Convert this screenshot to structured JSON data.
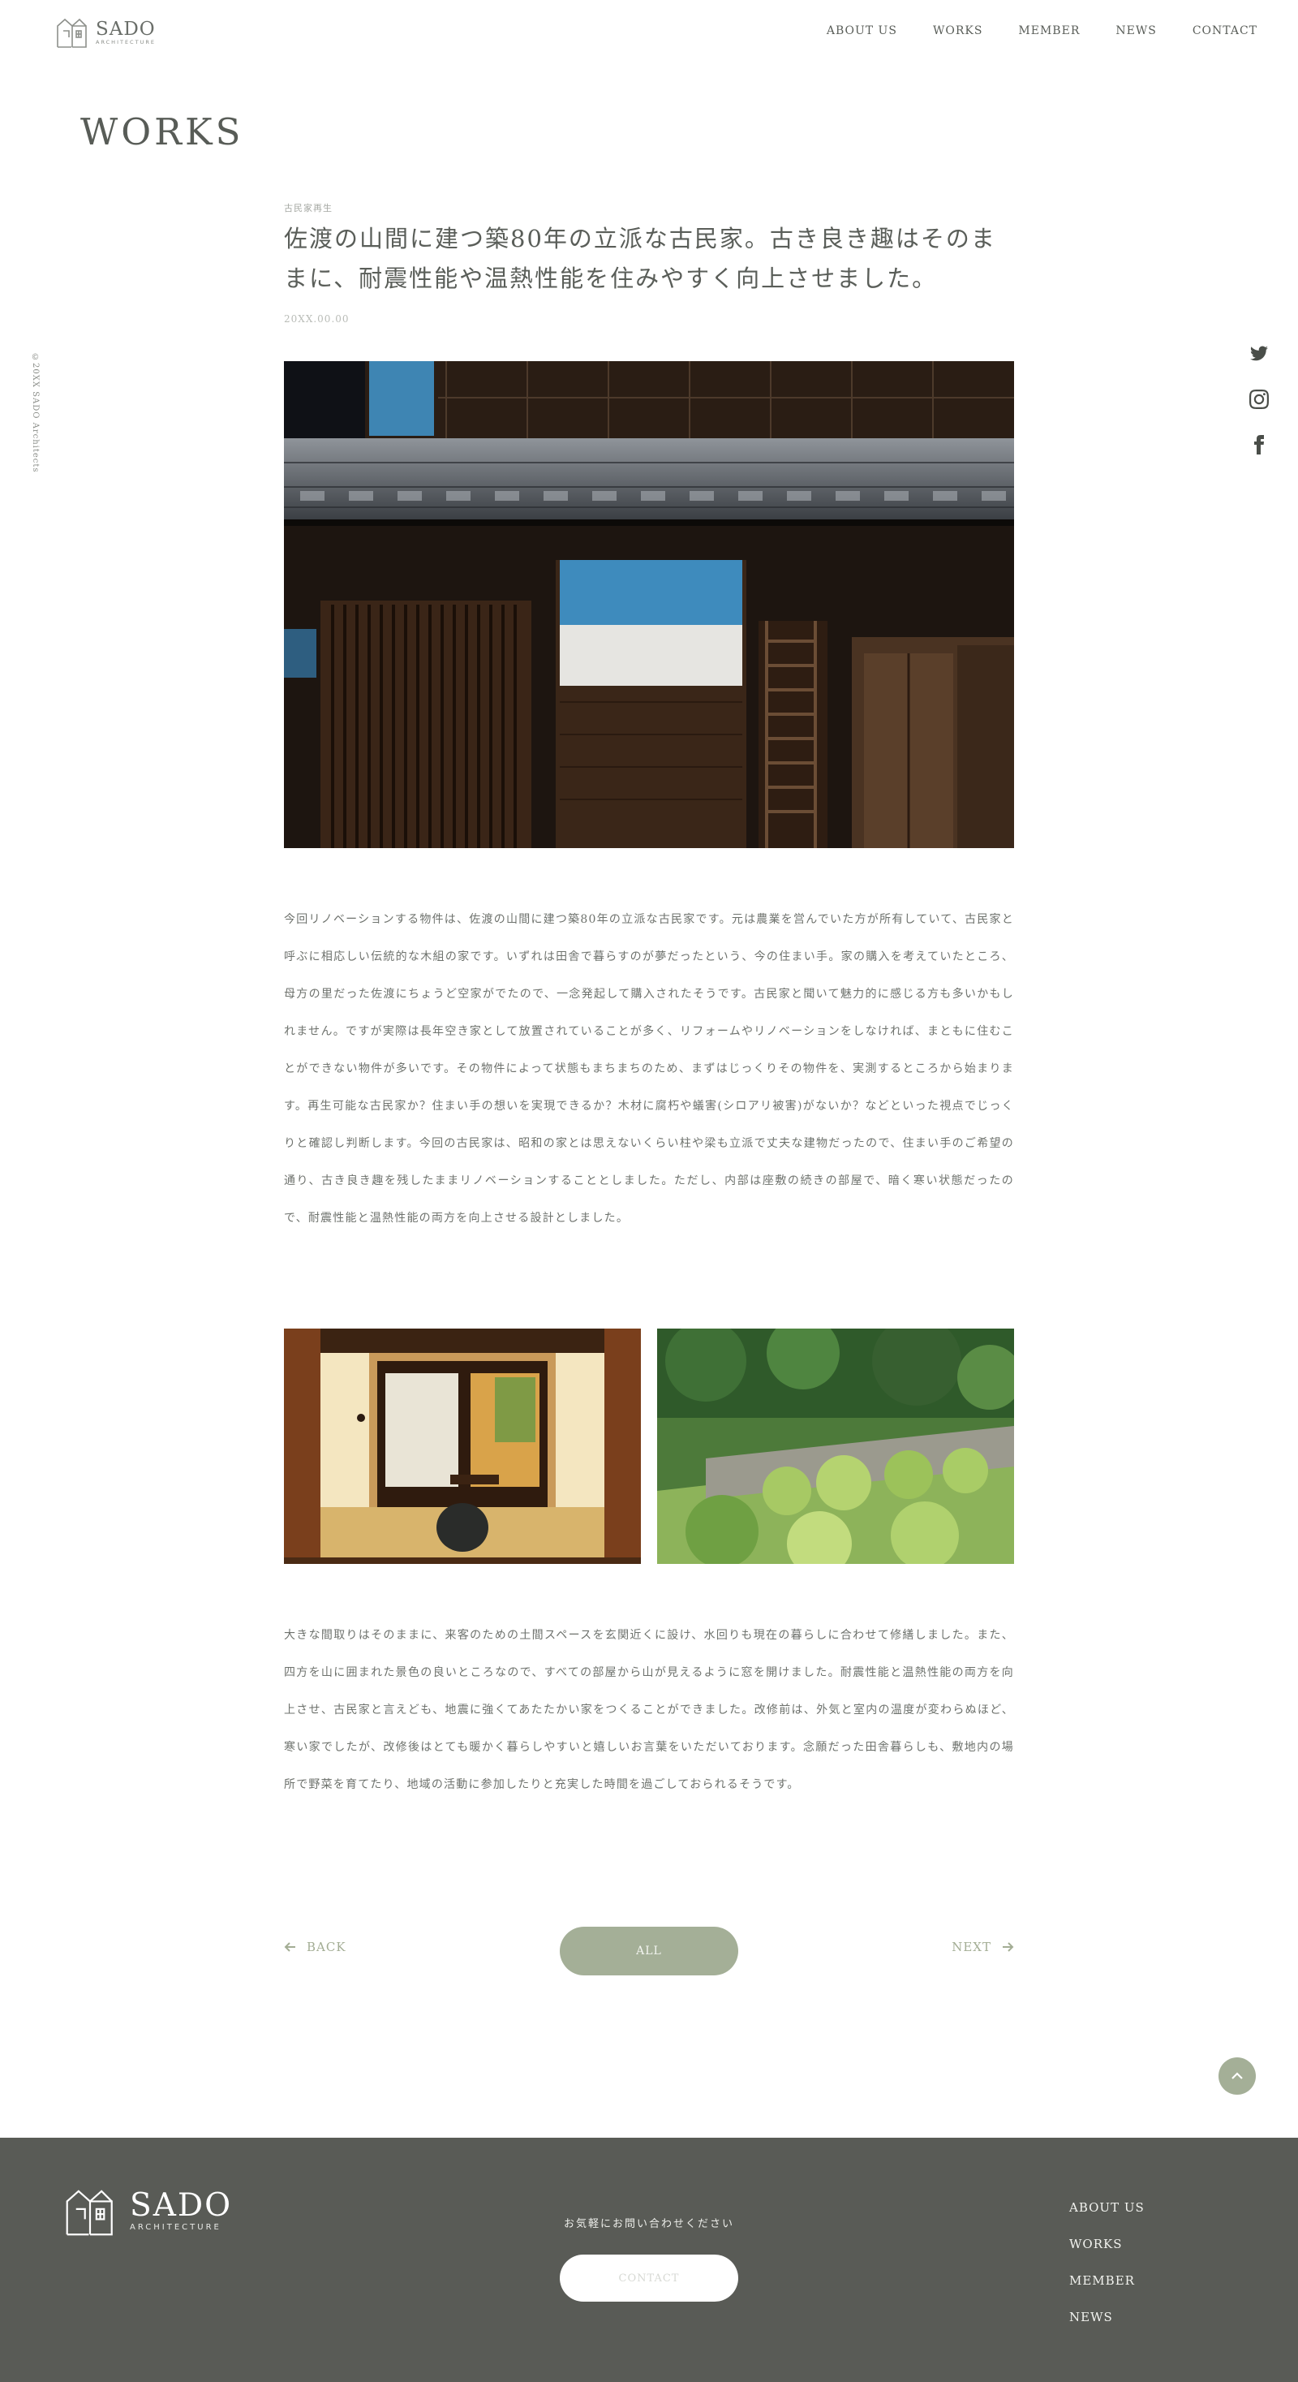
{
  "header": {
    "logo_name": "SADO",
    "logo_sub": "ARCHITECTURE",
    "nav": [
      "ABOUT US",
      "WORKS",
      "MEMBER",
      "NEWS",
      "CONTACT"
    ]
  },
  "page_title": "WORKS",
  "side": {
    "copyright": "©20XX SADO Architects",
    "social_icons": [
      "twitter-icon",
      "instagram-icon",
      "facebook-icon"
    ]
  },
  "article": {
    "category": "古民家再生",
    "title": "佐渡の山間に建つ築80年の立派な古民家。古き良き趣はそのままに、耐震性能や温熱性能を住みやすく向上させました。",
    "date": "20XX.00.00",
    "paragraph1": "今回リノベーションする物件は、佐渡の山間に建つ築80年の立派な古民家です。元は農業を営んでいた方が所有していて、古民家と呼ぶに相応しい伝統的な木組の家です。いずれは田舎で暮らすのが夢だったという、今の住まい手。家の購入を考えていたところ、母方の里だった佐渡にちょうど空家がでたので、一念発起して購入されたそうです。古民家と聞いて魅力的に感じる方も多いかもしれません。ですが実際は長年空き家として放置されていることが多く、リフォームやリノベーションをしなければ、まともに住むことができない物件が多いです。その物件によって状態もまちまちのため、まずはじっくりその物件を、実測するところから始まります。再生可能な古民家か？住まい手の想いを実現できるか？木材に腐朽や蟻害(シロアリ被害)がないか？などといった視点でじっくりと確認し判断します。今回の古民家は、昭和の家とは思えないくらい柱や梁も立派で丈夫な建物だったので、住まい手のご希望の通り、古き良き趣を残したままリノベーションすることとしました。ただし、内部は座敷の続きの部屋で、暗く寒い状態だったので、耐震性能と温熱性能の両方を向上させる設計としました。",
    "paragraph2": "大きな間取りはそのままに、来客のための土間スペースを玄関近くに設け、水回りも現在の暮らしに合わせて修繕しました。また、四方を山に囲まれた景色の良いところなので、すべての部屋から山が見えるように窓を開けました。耐震性能と温熱性能の両方を向上させ、古民家と言えども、地震に強くてあたたかい家をつくることができました。改修前は、外気と室内の温度が変わらぬほど、寒い家でしたが、改修後はとても暖かく暮らしやすいと嬉しいお言葉をいただいております。念願だった田舎暮らしも、敷地内の場所で野菜を育てたり、地域の活動に参加したりと充実した時間を過ごしておられるそうです。"
  },
  "pager": {
    "back": "BACK",
    "all": "ALL",
    "next": "NEXT"
  },
  "footer": {
    "logo_name": "SADO",
    "logo_sub": "ARCHITECTURE",
    "catch": "お気軽にお問い合わせください",
    "contact_button": "CONTACT",
    "nav": [
      "ABOUT US",
      "WORKS",
      "MEMBER",
      "NEWS"
    ]
  },
  "colors": {
    "accent": "#a4af97",
    "footer_bg": "#595b56",
    "text": "#5a5e59"
  }
}
